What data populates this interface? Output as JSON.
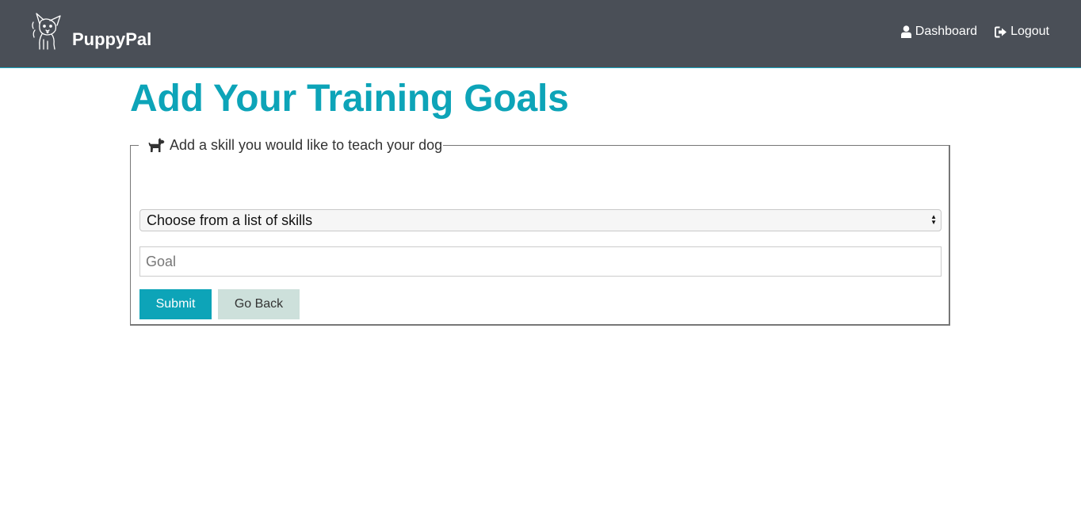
{
  "brand": {
    "name": "PuppyPal",
    "logo_icon": "chihuahua-logo-icon"
  },
  "nav": {
    "dashboard_label": "Dashboard",
    "dashboard_icon": "user-icon",
    "logout_label": "Logout",
    "logout_icon": "sign-out-icon"
  },
  "page": {
    "title": "Add Your Training Goals"
  },
  "form": {
    "legend": "Add a skill you would like to teach your dog",
    "legend_icon": "dog-icon",
    "skill_select": {
      "selected": "Choose from a list of skills"
    },
    "goal_input": {
      "value": "",
      "placeholder": "Goal"
    },
    "submit_label": "Submit",
    "back_label": "Go Back"
  },
  "colors": {
    "navbar_bg": "#4a4f57",
    "accent": "#0da4b8",
    "back_button_bg": "#cde0db"
  }
}
